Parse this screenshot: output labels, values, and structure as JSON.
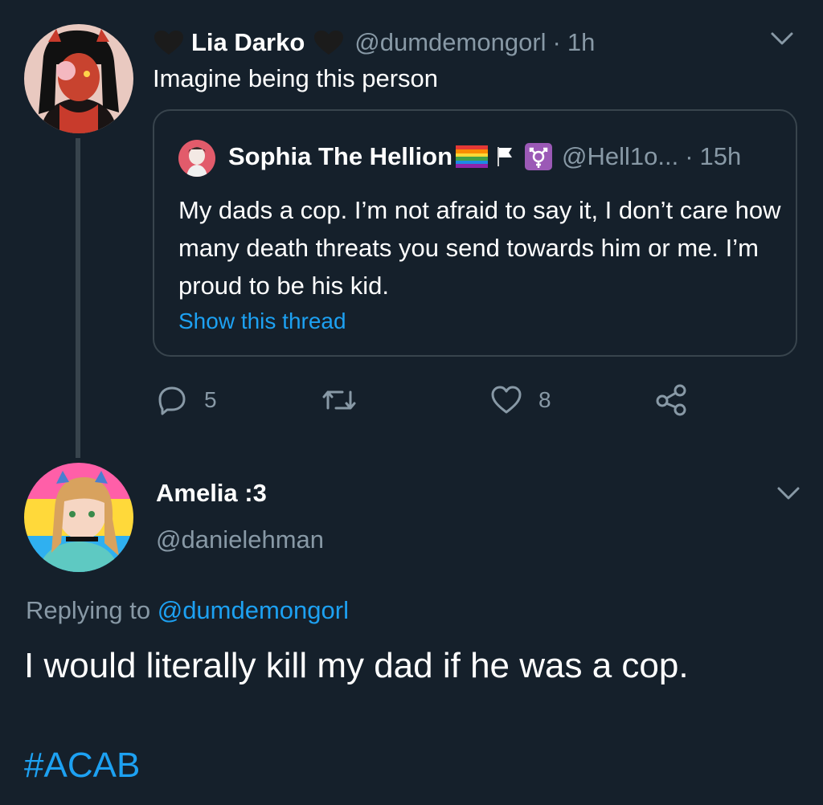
{
  "tweet": {
    "display_name": "Lia Darko",
    "handle": "@dumdemongorl",
    "separator": "·",
    "time": "1h",
    "text": "Imagine being this person",
    "name_decoration_icon": "black-heart-icon",
    "menu_icon": "chevron-down-icon"
  },
  "quote": {
    "display_name": "Sophia The Hellion",
    "emojis": [
      "rainbow-flag",
      "white-flag",
      "transgender-symbol"
    ],
    "handle": "@Hell1o...",
    "separator": "·",
    "time": "15h",
    "text": "My dads a cop. I’m not afraid to say it, I don’t care how many death threats you send towards him or me. I’m proud to be his kid.",
    "show_thread": "Show this thread"
  },
  "actions": {
    "reply_count": "5",
    "retweet_count": "",
    "like_count": "8",
    "icons": [
      "reply-icon",
      "retweet-icon",
      "like-icon",
      "share-icon"
    ]
  },
  "reply": {
    "display_name": "Amelia :3",
    "handle": "@danielehman",
    "replying_prefix": "Replying to",
    "replying_to": "@dumdemongorl",
    "text": "I would literally kill my dad if he was a cop.",
    "hashtag": "#ACAB"
  },
  "colors": {
    "background": "#15202b",
    "accent": "#1da1f2",
    "muted": "#8899a6",
    "border": "#38444d"
  }
}
